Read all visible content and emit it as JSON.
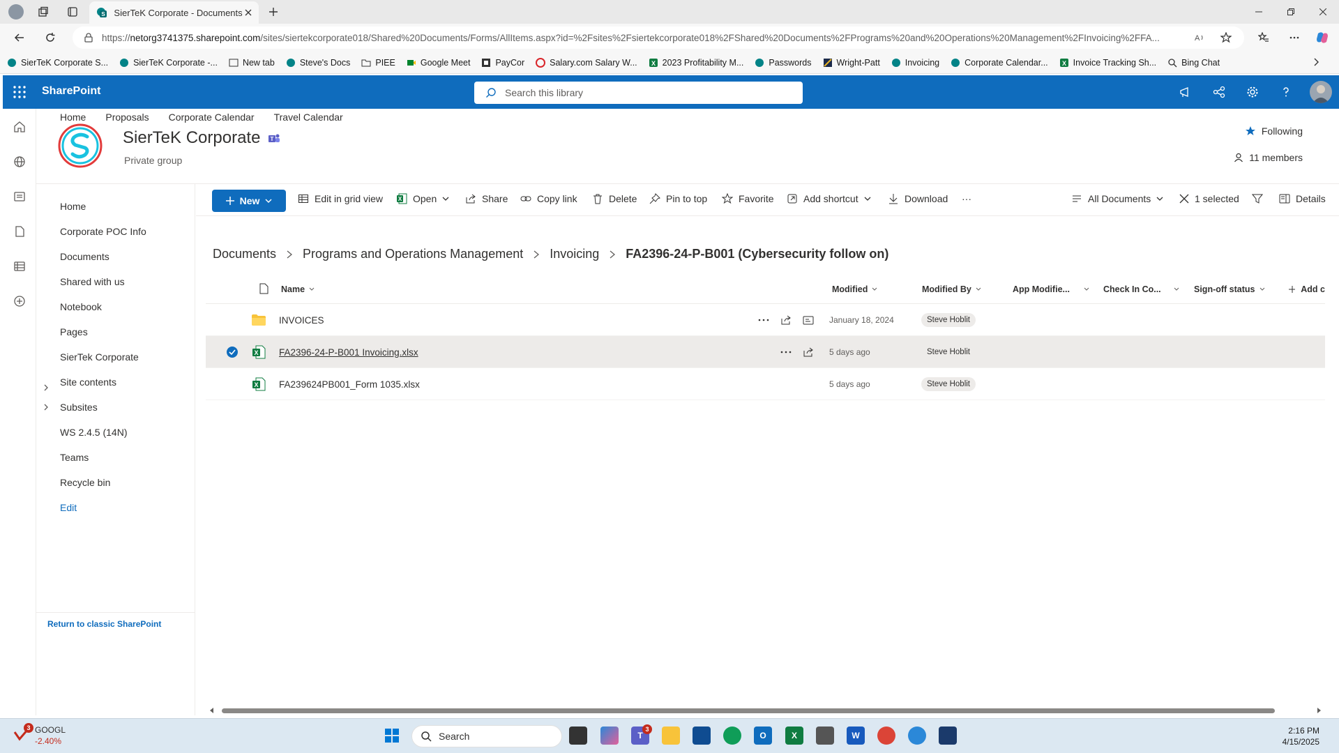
{
  "browser": {
    "tab_title": "SierTeK Corporate - Documents",
    "url_prefix": "https://",
    "url_host": "netorg3741375.sharepoint.com",
    "url_path": "/sites/siertekcorporate018/Shared%20Documents/Forms/AllItems.aspx?id=%2Fsites%2Fsiertekcorporate018%2FShared%20Documents%2FPrograms%20and%20Operations%20Management%2FInvoicing%2FFA...",
    "bookmarks": [
      "SierTeK Corporate S...",
      "SierTeK Corporate -...",
      "New tab",
      "Steve's Docs",
      "PIEE",
      "Google Meet",
      "PayCor",
      "Salary.com Salary W...",
      "2023 Profitability M...",
      "Passwords",
      "Wright-Patt",
      "Invoicing",
      "Corporate Calendar...",
      "Invoice Tracking Sh...",
      "Bing Chat"
    ]
  },
  "suitebar": {
    "brand": "SharePoint",
    "search_placeholder": "Search this library"
  },
  "site": {
    "hub_nav": [
      "Home",
      "Proposals",
      "Corporate Calendar",
      "Travel Calendar"
    ],
    "title": "SierTeK Corporate",
    "subtitle": "Private group",
    "following": "Following",
    "members": "11 members"
  },
  "leftnav": {
    "items": [
      "Home",
      "Corporate POC Info",
      "Documents",
      "Shared with us",
      "Notebook",
      "Pages",
      "SierTek Corporate",
      "Site contents",
      "Subsites",
      "WS 2.4.5 (14N)",
      "Teams",
      "Recycle bin"
    ],
    "edit": "Edit",
    "classic": "Return to classic SharePoint"
  },
  "commands": {
    "new": "New",
    "edit_grid": "Edit in grid view",
    "open": "Open",
    "share": "Share",
    "copy_link": "Copy link",
    "delete": "Delete",
    "pin": "Pin to top",
    "favorite": "Favorite",
    "add_shortcut": "Add shortcut",
    "download": "Download",
    "more": "···",
    "view": "All Documents",
    "selected": "1 selected",
    "details": "Details"
  },
  "breadcrumb": [
    "Documents",
    "Programs and Operations Management",
    "Invoicing",
    "FA2396-24-P-B001 (Cybersecurity follow on)"
  ],
  "list": {
    "columns": [
      "Name",
      "Modified",
      "Modified By",
      "App Modifie...",
      "Check In Co...",
      "Sign-off status",
      "Add c"
    ],
    "rows": [
      {
        "name": "INVOICES",
        "modified": "January 18, 2024",
        "modified_by": "Steve Hoblit",
        "type": "folder"
      },
      {
        "name": "FA2396-24-P-B001 Invoicing.xlsx",
        "modified": "5 days ago",
        "modified_by": "Steve Hoblit",
        "type": "excel",
        "selected": true
      },
      {
        "name": "FA239624PB001_Form 1035.xlsx",
        "modified": "5 days ago",
        "modified_by": "Steve Hoblit",
        "type": "excel"
      }
    ]
  },
  "taskbar": {
    "ticker": "GOOGL",
    "ticker_change": "-2.40%",
    "ticker_badge": "3",
    "search": "Search",
    "teams_badge": "3",
    "time": "2:16 PM",
    "date": "4/15/2025"
  },
  "colors": {
    "sharepoint_blue": "#0f6cbd",
    "excel_green": "#107c41",
    "folder_yellow": "#f8c33a"
  }
}
